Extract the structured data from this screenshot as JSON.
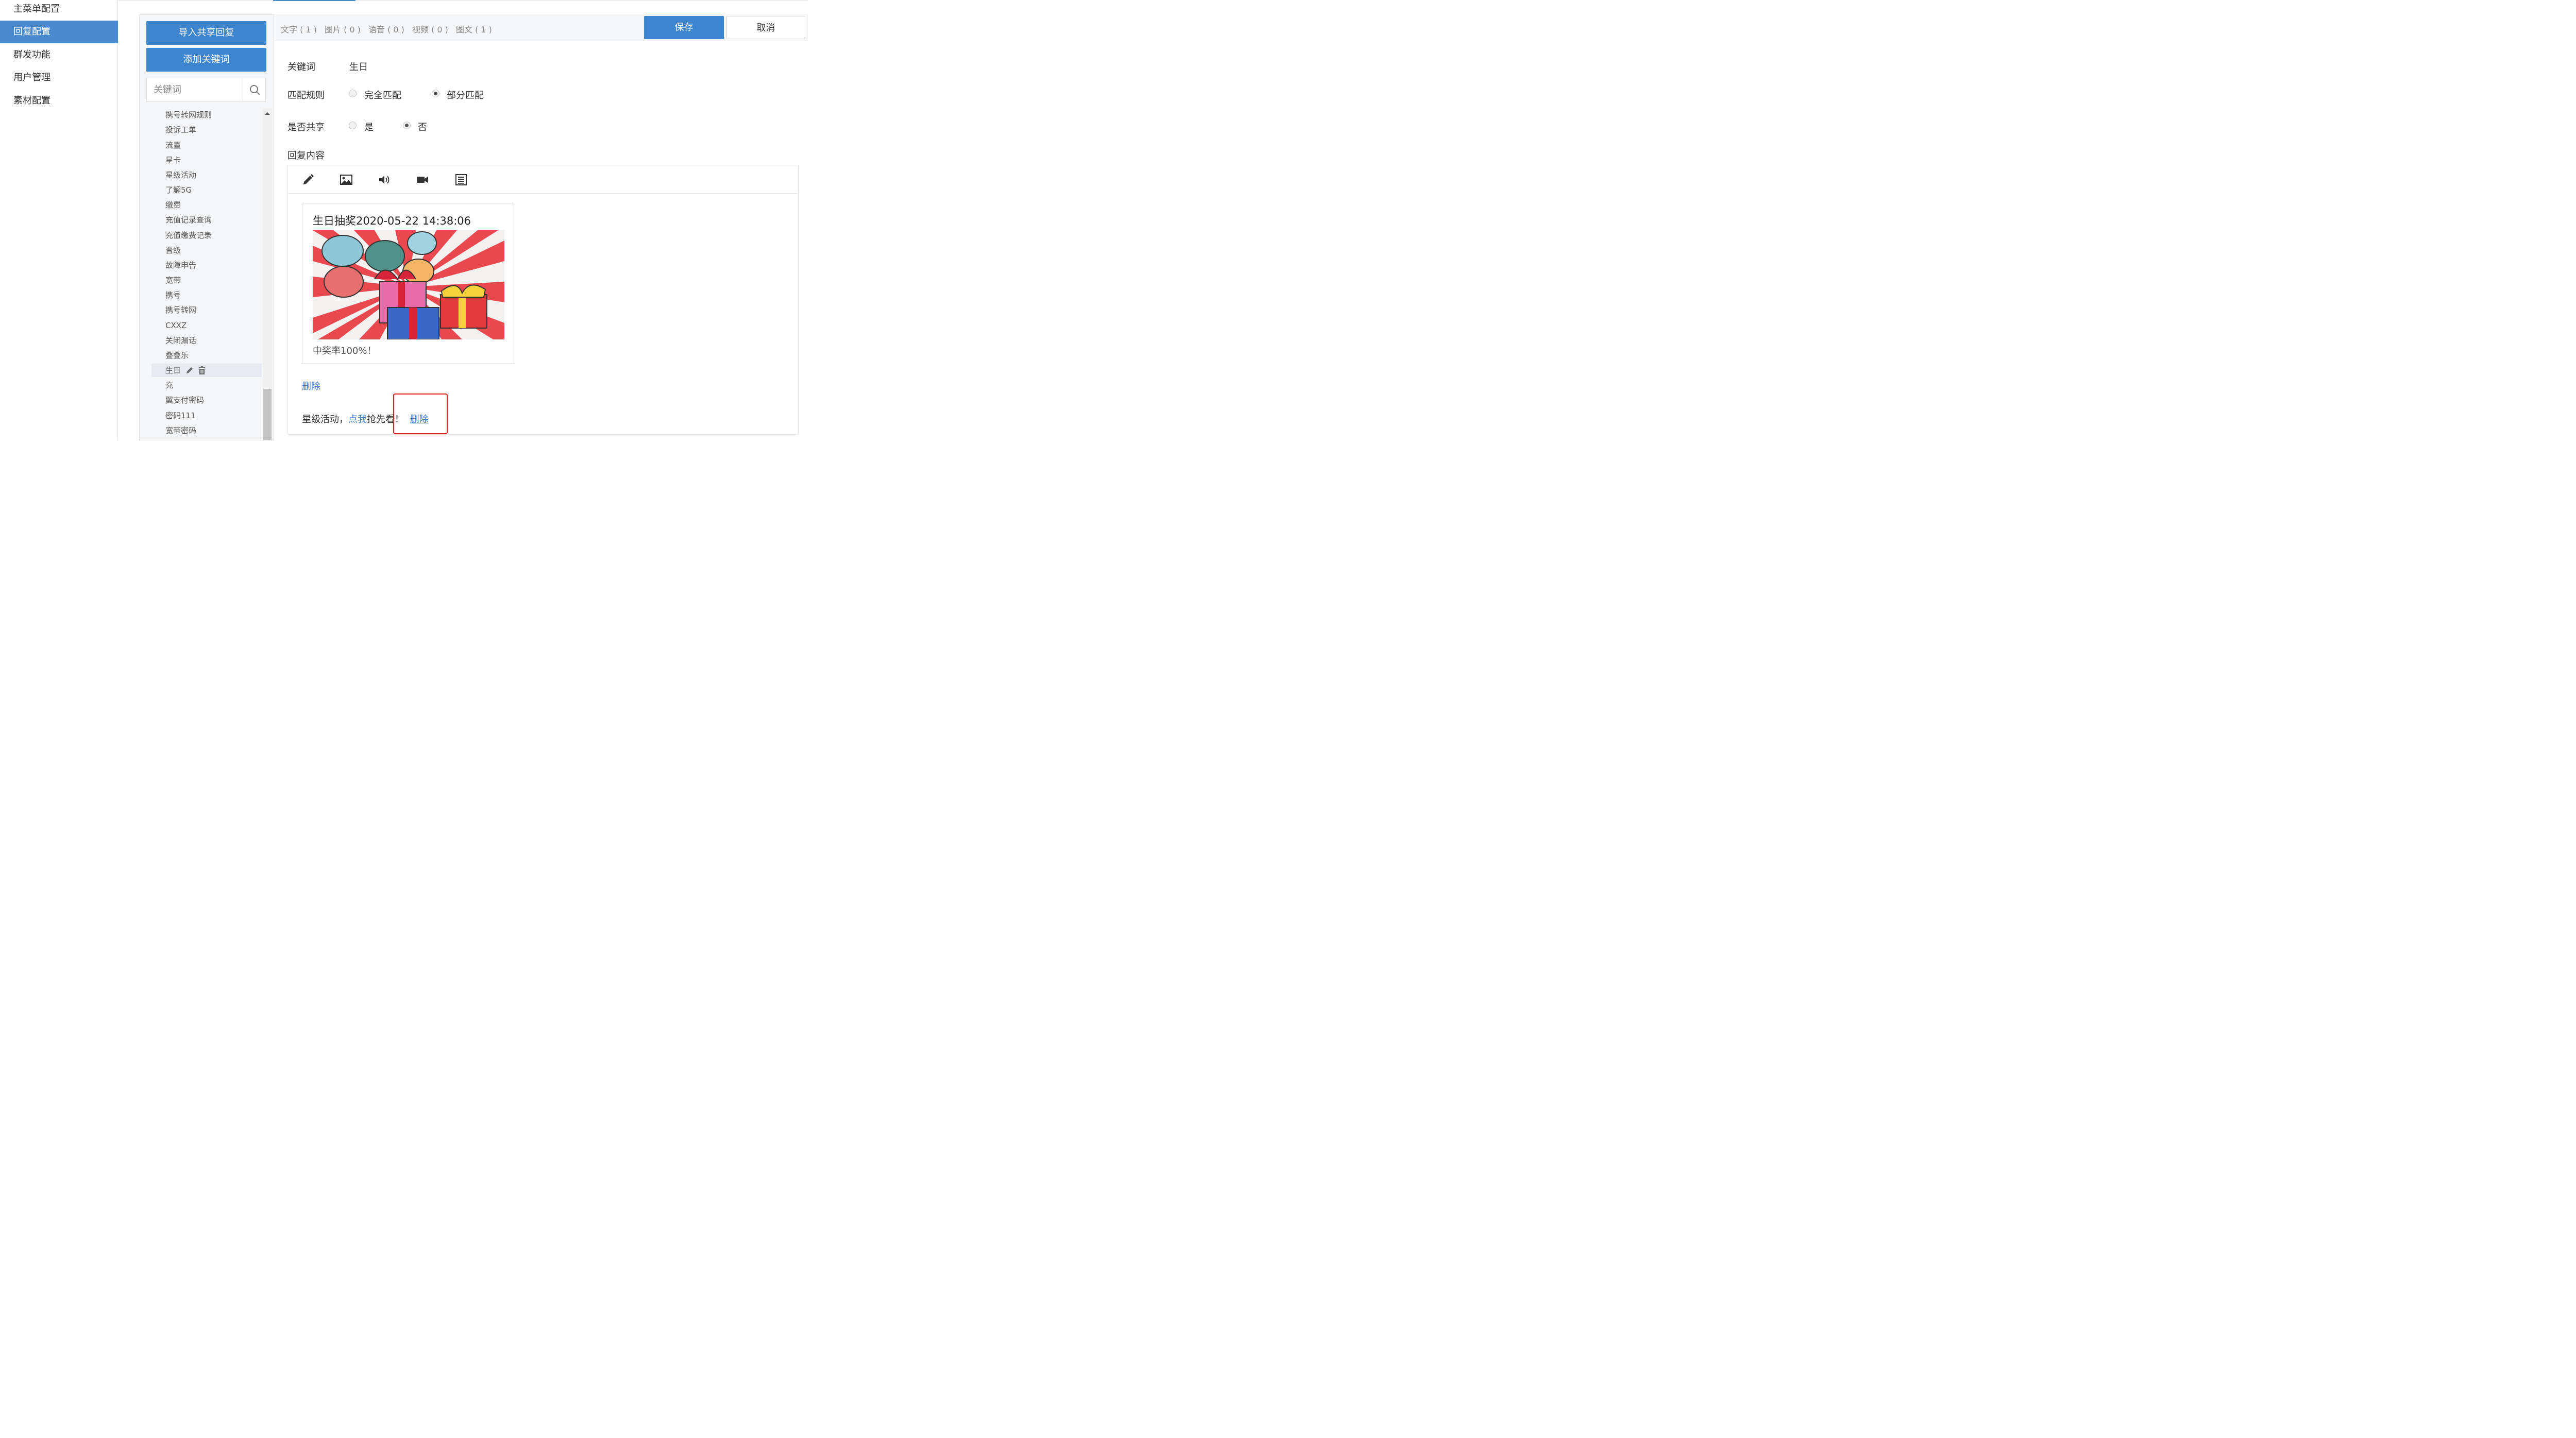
{
  "sidebar": {
    "items": [
      {
        "label": "主菜单配置"
      },
      {
        "label": "回复配置"
      },
      {
        "label": "群发功能"
      },
      {
        "label": "用户管理"
      },
      {
        "label": "素材配置"
      }
    ]
  },
  "middle": {
    "import_shared_label": "导入共享回复",
    "add_keyword_label": "添加关键词",
    "search": {
      "placeholder": "关键词",
      "icon": "search-icon"
    },
    "keywords": [
      "携号转网规则",
      "投诉工单",
      "流量",
      "星卡",
      "星级活动",
      "了解5G",
      "缴费",
      "充值记录查询",
      "充值缴费记录",
      "晋级",
      "故障申告",
      "宽带",
      "携号",
      "携号转网",
      "CXXZ",
      "关闭漏话",
      "叠叠乐",
      "生日",
      "充",
      "翼支付密码",
      "密码111",
      "宽带密码"
    ],
    "selected_keyword": "生日",
    "selected_actions": [
      "pencil-icon",
      "trash-icon"
    ]
  },
  "tabs": [
    {
      "label": "文字 ( 1 )"
    },
    {
      "label": "图片 ( 0 )"
    },
    {
      "label": "语音 ( 0 )"
    },
    {
      "label": "视频 ( 0 )"
    },
    {
      "label": "图文 ( 1 )"
    }
  ],
  "actions": {
    "save_label": "保存",
    "cancel_label": "取消"
  },
  "form": {
    "keyword_label": "关键词",
    "keyword_value": "生日",
    "match_label": "匹配规则",
    "match_options": [
      {
        "label": "完全匹配",
        "checked": false
      },
      {
        "label": "部分匹配",
        "checked": true
      }
    ],
    "share_label": "是否共享",
    "share_options": [
      {
        "label": "是",
        "checked": false
      },
      {
        "label": "否",
        "checked": true
      }
    ],
    "content_label": "回复内容"
  },
  "editor": {
    "tools": [
      "pencil-icon",
      "image-icon",
      "speaker-icon",
      "video-camera-icon",
      "article-icon"
    ],
    "card": {
      "title": "生日抽奖2020-05-22 14:38:06",
      "description": "中奖率100%！"
    },
    "delete_label": "删除",
    "text_line": {
      "prefix": "星级活动，",
      "link": "点我",
      "suffix": "抢先看！",
      "delete_label": "删除"
    }
  },
  "colors": {
    "accent": "#3d86cf",
    "link": "#3a7fd5",
    "highlight_box": "#e02020"
  }
}
